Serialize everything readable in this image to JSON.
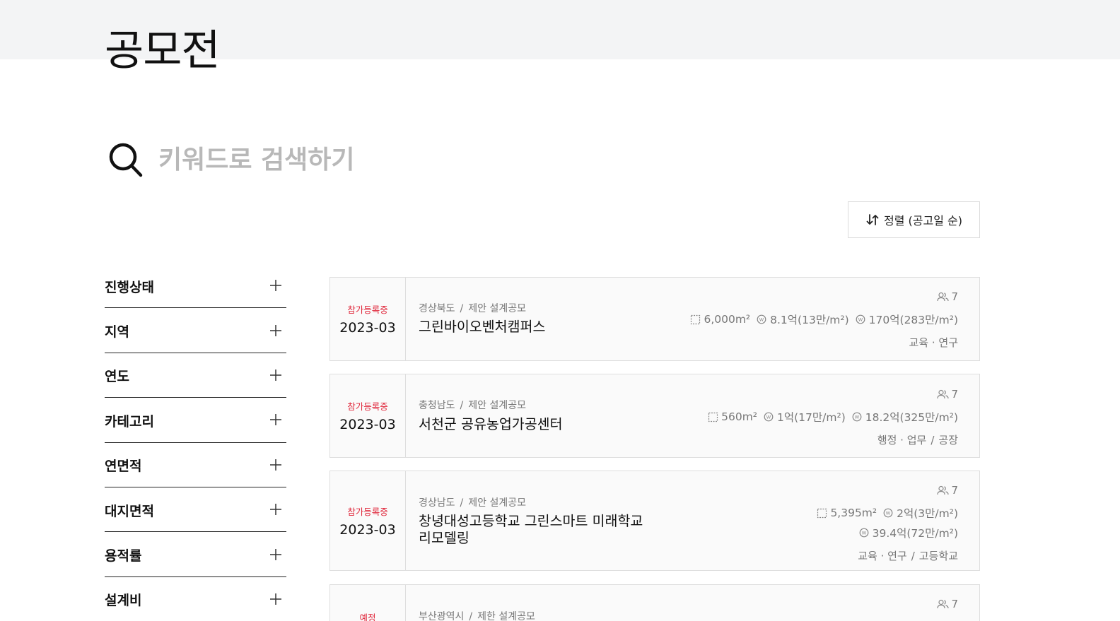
{
  "page": {
    "title": "공모전"
  },
  "search": {
    "placeholder": "키워드로 검색하기"
  },
  "sort": {
    "label": "정렬 (공고일 순)"
  },
  "filters": [
    {
      "label": "진행상태"
    },
    {
      "label": "지역"
    },
    {
      "label": "연도"
    },
    {
      "label": "카테고리"
    },
    {
      "label": "연면적"
    },
    {
      "label": "대지면적"
    },
    {
      "label": "용적률"
    },
    {
      "label": "설계비"
    }
  ],
  "colors": {
    "status": "#e0283c",
    "band": "#f3f4f5",
    "border": "#dedede"
  },
  "competitions": [
    {
      "status": "참가등록중",
      "date": "2023-03",
      "region": "경상북도",
      "type": "제안 설계공모",
      "title": "그린바이오벤처캠퍼스",
      "participants": "7",
      "area": "6,000m²",
      "design_fee": "8.1억(13만/m²)",
      "construction_cost": "170억(283만/m²)",
      "category": "교육 · 연구",
      "subcategory": ""
    },
    {
      "status": "참가등록중",
      "date": "2023-03",
      "region": "충청남도",
      "type": "제안 설계공모",
      "title": "서천군 공유농업가공센터",
      "participants": "7",
      "area": "560m²",
      "design_fee": "1억(17만/m²)",
      "construction_cost": "18.2억(325만/m²)",
      "category": "행정 · 업무",
      "subcategory": "공장"
    },
    {
      "status": "참가등록중",
      "date": "2023-03",
      "region": "경상남도",
      "type": "제안 설계공모",
      "title": "창녕대성고등학교 그린스마트 미래학교",
      "title_line2": "리모델링",
      "participants": "7",
      "area": "5,395m²",
      "design_fee": "2억(3만/m²)",
      "construction_cost": "39.4억(72만/m²)",
      "category": "교육 · 연구",
      "subcategory": "고등학교"
    },
    {
      "status": "예정",
      "region": "부산광역시",
      "type": "제한 설계공모",
      "participants": "7"
    }
  ]
}
